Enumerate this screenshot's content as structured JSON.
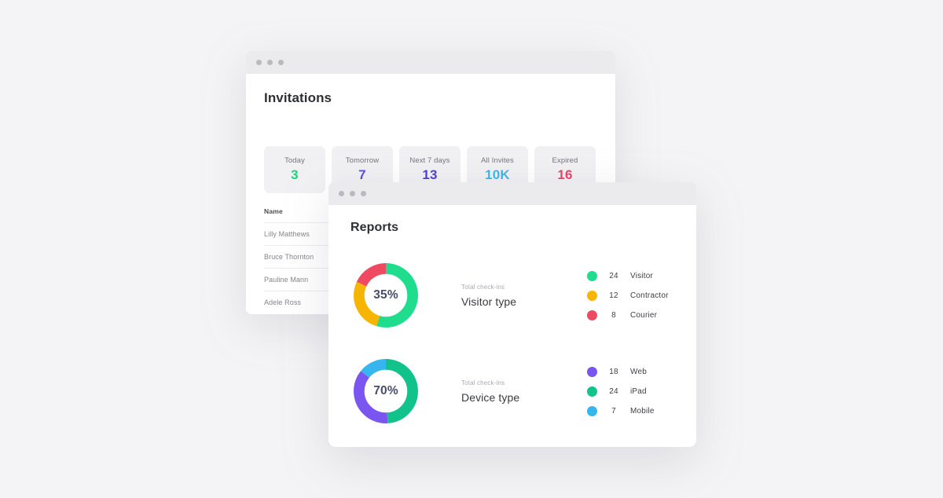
{
  "background_color": "#f4f4f6",
  "windows": {
    "invitations": {
      "title": "Invitations",
      "traffic_lights": [
        "window-dot",
        "window-dot",
        "window-dot"
      ],
      "stats": [
        {
          "label": "Today",
          "value": "3",
          "color": "#20d47f"
        },
        {
          "label": "Tomorrow",
          "value": "7",
          "color": "#5b4ce0"
        },
        {
          "label": "Next 7 days",
          "value": "13",
          "color": "#4d3fd4"
        },
        {
          "label": "All Invites",
          "value": "10K",
          "color": "#3bb8e8"
        },
        {
          "label": "Expired",
          "value": "16",
          "color": "#e8436b"
        }
      ],
      "table": {
        "columns": [
          "Name"
        ],
        "rows": [
          {
            "name": "Lilly Matthews"
          },
          {
            "name": "Bruce Thornton"
          },
          {
            "name": "Pauline Mann"
          },
          {
            "name": "Adele Ross"
          }
        ]
      }
    },
    "reports": {
      "title": "Reports",
      "traffic_lights": [
        "window-dot",
        "window-dot",
        "window-dot"
      ]
    }
  },
  "chart_data": [
    {
      "type": "pie",
      "title": "Visitor type",
      "subtitle": "Total check-ins",
      "center_label": "35%",
      "categories": [
        "Visitor",
        "Contractor",
        "Courier"
      ],
      "values": [
        24,
        12,
        8
      ],
      "colors": [
        "#1fdd8d",
        "#f6b500",
        "#ef4a62"
      ],
      "legend_position": "right",
      "donut": true
    },
    {
      "type": "pie",
      "title": "Device type",
      "subtitle": "Total check-ins",
      "center_label": "70%",
      "categories": [
        "Web",
        "iPad",
        "Mobile"
      ],
      "values": [
        18,
        24,
        7
      ],
      "colors": [
        "#7b55ef",
        "#11c28b",
        "#36b6ef"
      ],
      "legend_position": "right",
      "donut": true,
      "segment_order": [
        "iPad",
        "Web",
        "Mobile"
      ]
    }
  ]
}
